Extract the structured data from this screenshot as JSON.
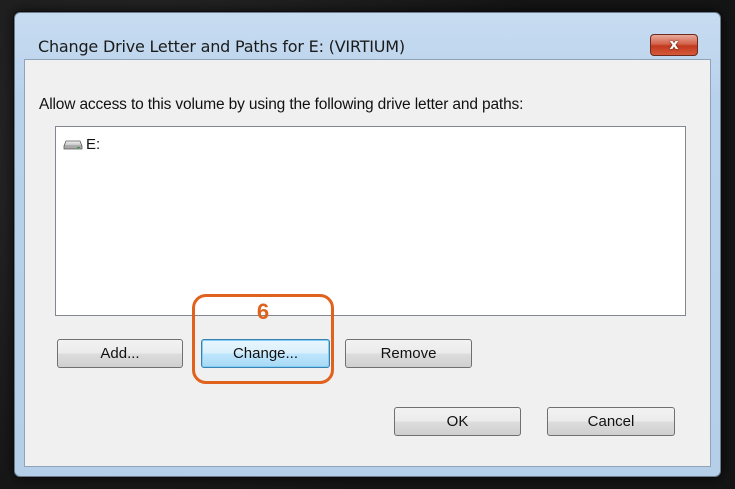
{
  "dialog": {
    "title": "Change Drive Letter and Paths for E: (VIRTIUM)",
    "close_label": "x",
    "instruction": "Allow access to this volume by using the following drive letter and paths:",
    "items": [
      {
        "label": "E:",
        "icon": "drive-icon"
      }
    ],
    "buttons": {
      "add": "Add...",
      "change": "Change...",
      "remove": "Remove",
      "ok": "OK",
      "cancel": "Cancel"
    }
  },
  "annotation": {
    "step_number": "6",
    "color": "#e0621d"
  }
}
